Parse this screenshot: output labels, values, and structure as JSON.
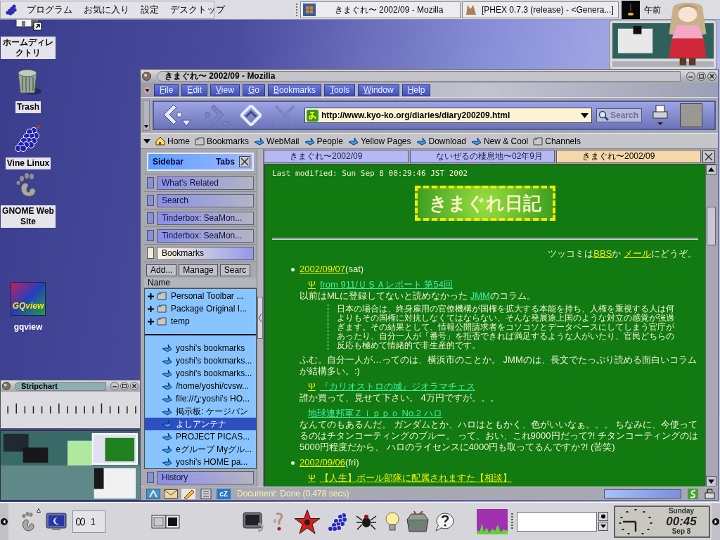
{
  "top_panel": {
    "menus": [
      "プログラム",
      "お気に入り",
      "設定",
      "デスクトップ"
    ],
    "tasks": [
      {
        "label": "きまぐれ〜 2002/09 - Mozilla",
        "kind": "browser"
      },
      {
        "label": "[PHEX 0.7.3 (release) - <Genera...]",
        "kind": "animal"
      }
    ],
    "clock": "午前"
  },
  "desktop_icons": [
    {
      "label": "ホームディレクトリ",
      "kind": "home",
      "boxed": true
    },
    {
      "label": "Trash",
      "kind": "trash",
      "boxed": true
    },
    {
      "label": "Vine Linux",
      "kind": "grapes",
      "boxed": true
    },
    {
      "label": "GNOME Web Site",
      "kind": "foot",
      "boxed": true
    },
    {
      "label": "gqview",
      "kind": "logo",
      "logo_text": "GQview",
      "boxed": false
    }
  ],
  "stripchart": {
    "title": "Stripchart"
  },
  "browser": {
    "title": "きまぐれ〜 2002/09 - Mozilla",
    "menus": [
      "File",
      "Edit",
      "View",
      "Go",
      "Bookmarks",
      "Tools",
      "Window",
      "Help"
    ],
    "nav_buttons": [
      {
        "kind": "back",
        "disabled": false
      },
      {
        "kind": "forward",
        "disabled": true
      },
      {
        "kind": "reload",
        "disabled": false
      },
      {
        "kind": "stop",
        "disabled": true
      }
    ],
    "url": "http://www.kyo-ko.org/diaries/diary200209.html",
    "search_button": "Search",
    "personal_toolbar": [
      {
        "label": "Home",
        "kind": "home"
      },
      {
        "label": "Bookmarks",
        "kind": "folder"
      },
      {
        "label": "WebMail",
        "kind": "link"
      },
      {
        "label": "People",
        "kind": "link"
      },
      {
        "label": "Yellow Pages",
        "kind": "link"
      },
      {
        "label": "Download",
        "kind": "link"
      },
      {
        "label": "New & Cool",
        "kind": "link"
      },
      {
        "label": "Channels",
        "kind": "folder"
      }
    ],
    "sidebar": {
      "title": "Sidebar",
      "tabs_label": "Tabs",
      "panels": [
        {
          "label": "What's Related",
          "selected": false
        },
        {
          "label": "Search",
          "selected": false
        },
        {
          "label": "Tinderbox: SeaMon...",
          "selected": false
        },
        {
          "label": "Tinderbox: SeaMon...",
          "selected": false
        },
        {
          "label": "Bookmarks",
          "selected": true
        },
        {
          "label": "History",
          "selected": false
        }
      ],
      "bookmarks": {
        "buttons": [
          "Add...",
          "Manage",
          "Searc"
        ],
        "column": "Name",
        "folders": [
          "Personal Toolbar ...",
          "Package Original I...",
          "temp"
        ],
        "items": [
          {
            "label": "yoshi's bookmarks",
            "selected": false
          },
          {
            "label": "yoshi's bookmarks...",
            "selected": false
          },
          {
            "label": "yoshi's bookmarks...",
            "selected": false
          },
          {
            "label": "/home/yoshi/cvsw...",
            "selected": false
          },
          {
            "label": "file://なyoshi's HO...",
            "selected": false
          },
          {
            "label": "掲示板: ケージバン",
            "selected": false
          },
          {
            "label": "よしアンテナ",
            "selected": true
          },
          {
            "label": "PROJECT PICAS...",
            "selected": false
          },
          {
            "label": "eグループ Myグル...",
            "selected": false
          },
          {
            "label": "yoshi's HOME pa...",
            "selected": false
          }
        ]
      }
    },
    "tabs": [
      {
        "label": "きまぐれ〜2002/09",
        "selected": false
      },
      {
        "label": "ないぜるの棲息地〜02年9月",
        "selected": false
      },
      {
        "label": "きまぐれ〜2002/09",
        "selected": true
      }
    ],
    "page": {
      "last_modified": "Last modified: Sun Sep 8 00:29:46 JST 2002",
      "logo": "きまぐれ日記",
      "contact": [
        {
          "text": "ツッコミは"
        },
        {
          "text": "BBS",
          "link": true,
          "visited": false
        },
        {
          "text": "か "
        },
        {
          "text": "メール",
          "link": true,
          "visited": false
        },
        {
          "text": "にどうぞ。"
        }
      ],
      "entries": [
        {
          "date": "2002/09/07",
          "day": "(sat)",
          "blocks": [
            {
              "kind": "headline",
              "mark": "Ψ",
              "link": "from 911/ＵＳＡレポート 第54回",
              "visited": true
            },
            {
              "kind": "text",
              "segments": [
                {
                  "text": "以前はMLに登録してないと読めなかった "
                },
                {
                  "text": "JMM",
                  "link": true,
                  "visited": true
                },
                {
                  "text": "のコラム。"
                }
              ]
            },
            {
              "kind": "quote",
              "text": "日本の場合は、終身雇用の官僚機構が国権を拡大する本能を持ち、人権を重視する人は何よりもその国権に対抗しなくてはならない、そんな発展途上国のような対立の感覚が強過ぎます。その結果として、情報公開請求者をコソコソとデータベースにしてしまう官庁があったり、自分一人が「番号」を拒否できれば満足するような人がいたり、官民どちらの反応も極めて情緒的で非生産的です。"
            },
            {
              "kind": "text",
              "segments": [
                {
                  "text": "ふむ。自分一人が…ってのは、横浜市のことか。 JMMのは、長文でたっぷり読める面白いコラムが結構多い。:)"
                }
              ]
            },
            {
              "kind": "headline",
              "mark": "Ψ",
              "link": "『カリオストロの城』ジオラマチェス",
              "visited": true
            },
            {
              "kind": "text",
              "segments": [
                {
                  "text": "誰か買って、見せて下さい。 4万円ですが。。。"
                }
              ]
            },
            {
              "kind": "headline",
              "link": "地球連邦軍Ｚｉｐｐｏ No.2 ハロ",
              "visited": true
            },
            {
              "kind": "text",
              "segments": [
                {
                  "text": "なんてのもあるんだ。 ガンダムとか、ハロはともかく、色がいいなぁ。。。 ちなみに、今使ってるのはチタンコーティングのブルー。 って、おい、これ9000円だって?! チタンコーティングのは5000円程度だから、 ハロのライセンスに4000円も取ってるんですか?! (苦笑)"
                }
              ]
            }
          ]
        },
        {
          "date": "2002/09/06",
          "day": "(fri)",
          "blocks": [
            {
              "kind": "headline",
              "mark": "Ψ",
              "link": "【人生】ボール部隊に配属されますた【相談】",
              "visited": false
            }
          ]
        }
      ]
    },
    "components": [
      {
        "kind": "navigator"
      },
      {
        "kind": "mail"
      },
      {
        "kind": "composer"
      },
      {
        "kind": "addressbook"
      },
      {
        "kind": "chat",
        "label": "cZ"
      }
    ],
    "status": "Document: Done (0.478 secs)",
    "progress": {
      "level": 0
    }
  },
  "bottom_panel": {
    "workspace": "1",
    "clock": {
      "day": "Sunday",
      "time": "00:45",
      "date": "Sep 8"
    }
  }
}
